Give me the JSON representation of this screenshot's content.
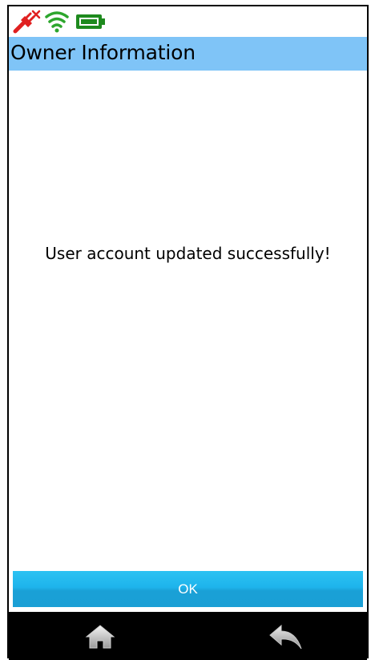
{
  "status_bar": {
    "icons": [
      "no-power-icon",
      "wifi-icon",
      "battery-icon"
    ]
  },
  "header": {
    "title": "Owner Information"
  },
  "main": {
    "message": "User account updated successfully!"
  },
  "actions": {
    "ok_label": "OK"
  },
  "nav": {
    "icons": [
      "home-icon",
      "back-icon"
    ]
  },
  "colors": {
    "title_bar": "#7fc4f7",
    "ok_button": "#1eb4ec",
    "nav_bar": "#000000",
    "status_power": "#e02020",
    "status_wifi": "#2da62d",
    "status_battery": "#1e8a1e"
  }
}
